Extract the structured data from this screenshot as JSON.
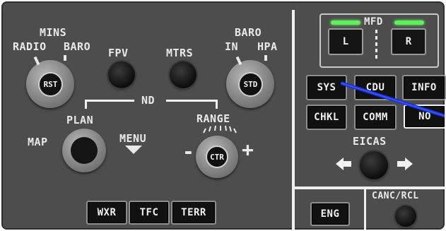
{
  "efis": {
    "mins": {
      "title": "MINS",
      "left": "RADIO",
      "right": "BARO",
      "knob_center": "RST"
    },
    "fpv": "FPV",
    "mtrs": "MTRS",
    "baro": {
      "title": "BARO",
      "left": "IN",
      "right": "HPA",
      "knob_center": "STD"
    },
    "nd": {
      "label": "ND",
      "plan": "PLAN",
      "map": "MAP",
      "menu": "MENU",
      "range": "RANGE",
      "range_center": "CTR",
      "minus": "-",
      "plus": "+"
    },
    "bottom_keys": [
      "WXR",
      "TFC",
      "TERR"
    ]
  },
  "display_select": {
    "mfd_label": "MFD",
    "mfd_left": "L",
    "mfd_right": "R",
    "row1": [
      "SYS",
      "CDU",
      "INFO"
    ],
    "row2": [
      "CHKL",
      "COMM",
      "NO"
    ],
    "eicas": "EICAS",
    "eng": "ENG",
    "canc_rcl": "CANC/RCL"
  },
  "colors": {
    "panel": "#4d4d4d",
    "text": "#e9e9e9",
    "led": "#5df05d",
    "pointer": "#1630d8"
  }
}
